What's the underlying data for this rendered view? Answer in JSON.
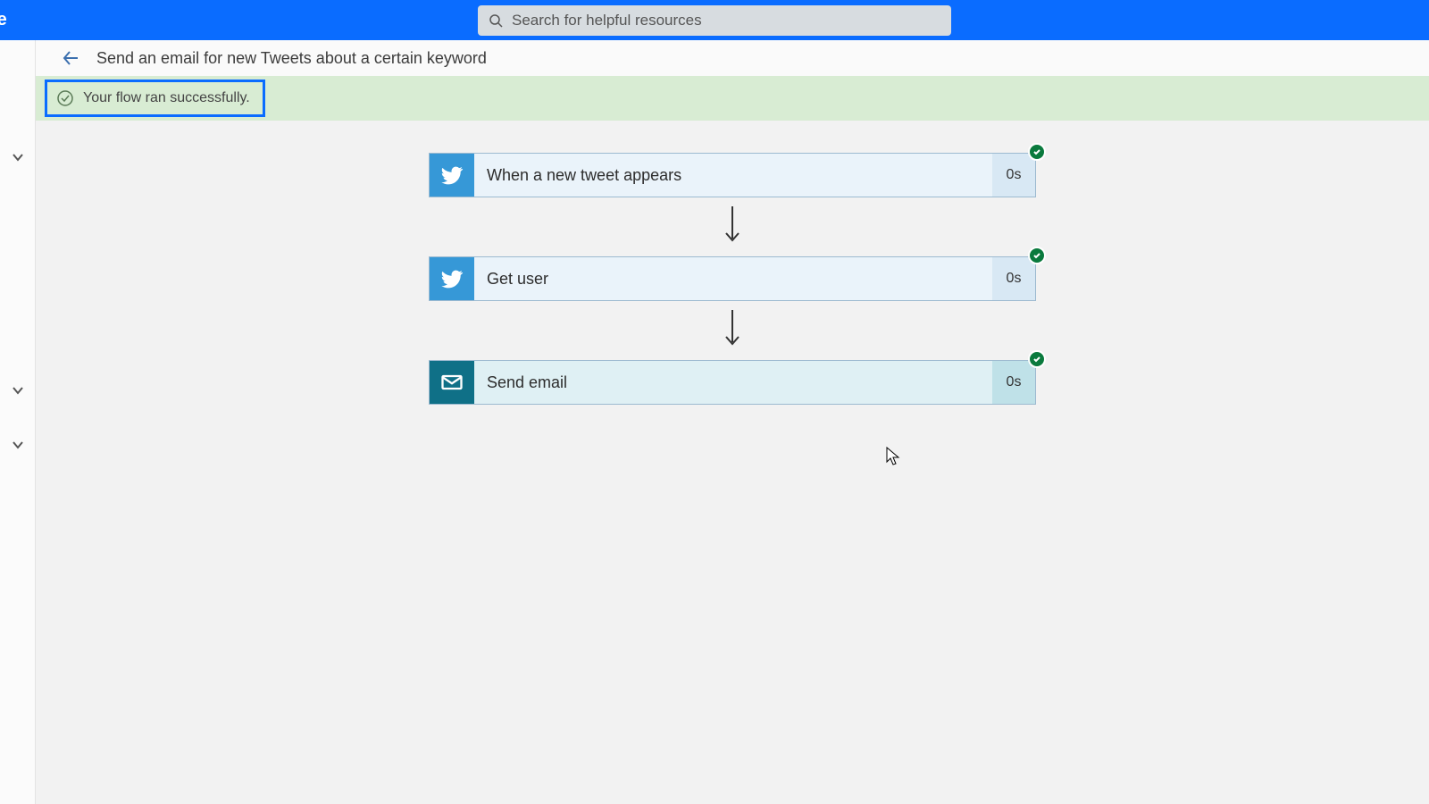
{
  "topbar": {
    "left_fragment": "te",
    "search_placeholder": "Search for helpful resources"
  },
  "header": {
    "title": "Send an email for new Tweets about a certain keyword"
  },
  "banner": {
    "message": "Your flow ran successfully."
  },
  "steps": [
    {
      "icon": "twitter",
      "label": "When a new tweet appears",
      "time": "0s",
      "tone": "light"
    },
    {
      "icon": "twitter",
      "label": "Get user",
      "time": "0s",
      "tone": "light"
    },
    {
      "icon": "mail",
      "label": "Send email",
      "time": "0s",
      "tone": "darker"
    }
  ]
}
